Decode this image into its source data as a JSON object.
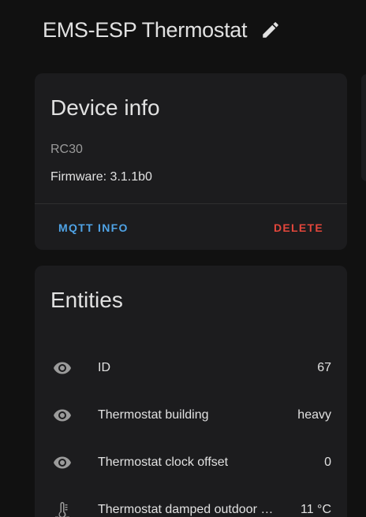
{
  "header": {
    "title": "EMS-ESP Thermostat",
    "edit_icon": "pencil-icon"
  },
  "device_info": {
    "title": "Device info",
    "model": "RC30",
    "firmware": "Firmware: 3.1.1b0",
    "mqtt_info_label": "MQTT INFO",
    "delete_label": "DELETE"
  },
  "entities": {
    "title": "Entities",
    "items": [
      {
        "icon": "eye-icon",
        "name": "ID",
        "value": "67"
      },
      {
        "icon": "eye-icon",
        "name": "Thermostat building",
        "value": "heavy"
      },
      {
        "icon": "eye-icon",
        "name": "Thermostat clock offset",
        "value": "0"
      },
      {
        "icon": "thermometer-icon",
        "name": "Thermostat damped outdoor …",
        "value": "11 °C"
      }
    ]
  },
  "colors": {
    "background": "#111111",
    "card": "#1c1c1e",
    "accent_blue": "#4fa3e6",
    "accent_red": "#e2463b"
  }
}
